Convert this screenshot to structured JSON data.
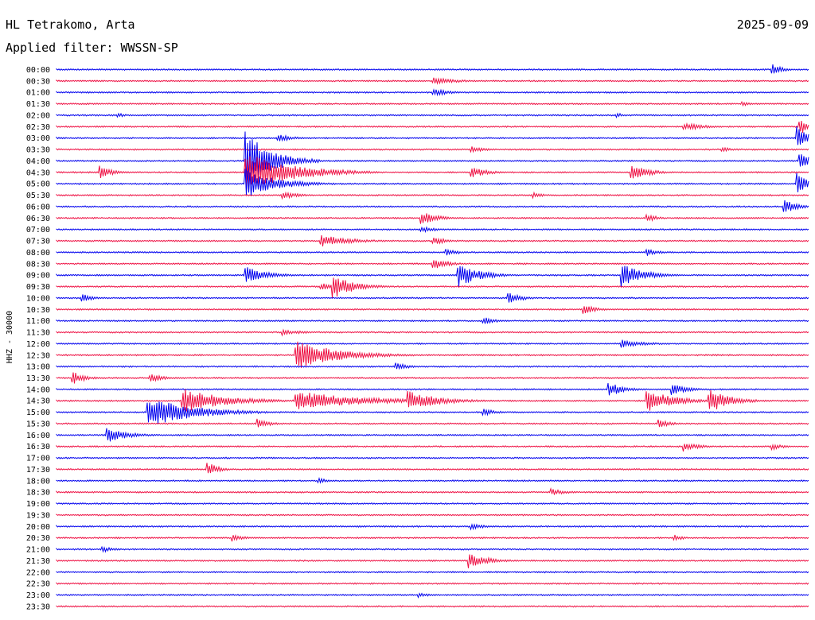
{
  "header": {
    "station": "HL Tetrakomo, Arta",
    "date": "2025-09-09",
    "filter": "Applied filter: WWSSN-SP"
  },
  "chart_data": {
    "type": "line",
    "title": "HL Tetrakomo, Arta",
    "subtitle": "Applied filter: WWSSN-SP",
    "date": "2025-09-09",
    "ylabel": "HHZ - 30000",
    "row_labels": [
      "00:00",
      "00:30",
      "01:00",
      "01:30",
      "02:00",
      "02:30",
      "03:00",
      "03:30",
      "04:00",
      "04:30",
      "05:00",
      "05:30",
      "06:00",
      "06:30",
      "07:00",
      "07:30",
      "08:00",
      "08:30",
      "09:00",
      "09:30",
      "10:00",
      "10:30",
      "11:00",
      "11:30",
      "12:00",
      "12:30",
      "13:00",
      "13:30",
      "14:00",
      "14:30",
      "15:00",
      "15:30",
      "16:00",
      "16:30",
      "17:00",
      "17:30",
      "18:00",
      "18:30",
      "19:00",
      "19:30",
      "20:00",
      "20:30",
      "21:00",
      "21:30",
      "22:00",
      "22:30",
      "23:00",
      "23:30"
    ],
    "row_minutes": 30,
    "series_colors": [
      "#0000ee",
      "#ee1144"
    ],
    "events": [
      {
        "row": 0,
        "min": 28.5,
        "amp": 1.2,
        "dur": 0.4
      },
      {
        "row": 1,
        "min": 15.0,
        "amp": 0.7,
        "dur": 1.0
      },
      {
        "row": 2,
        "min": 15.0,
        "amp": 0.8,
        "dur": 0.6
      },
      {
        "row": 3,
        "min": 27.3,
        "amp": 0.6,
        "dur": 0.3
      },
      {
        "row": 4,
        "min": 2.4,
        "amp": 0.6,
        "dur": 0.3
      },
      {
        "row": 4,
        "min": 22.3,
        "amp": 0.6,
        "dur": 0.3
      },
      {
        "row": 5,
        "min": 25.0,
        "amp": 0.8,
        "dur": 0.8
      },
      {
        "row": 5,
        "min": 29.6,
        "amp": 1.8,
        "dur": 0.4
      },
      {
        "row": 6,
        "min": 8.8,
        "amp": 0.8,
        "dur": 0.6
      },
      {
        "row": 6,
        "min": 29.5,
        "amp": 2.5,
        "dur": 0.5
      },
      {
        "row": 7,
        "min": 16.5,
        "amp": 0.8,
        "dur": 0.5
      },
      {
        "row": 7,
        "min": 26.5,
        "amp": 0.6,
        "dur": 0.4
      },
      {
        "row": 8,
        "min": 7.5,
        "amp": 6.0,
        "dur": 1.0
      },
      {
        "row": 8,
        "min": 29.6,
        "amp": 2.5,
        "dur": 0.4
      },
      {
        "row": 9,
        "min": 1.7,
        "amp": 1.4,
        "dur": 0.5
      },
      {
        "row": 9,
        "min": 7.5,
        "amp": 4.0,
        "dur": 1.8
      },
      {
        "row": 9,
        "min": 16.5,
        "amp": 1.2,
        "dur": 0.6
      },
      {
        "row": 9,
        "min": 22.9,
        "amp": 2.0,
        "dur": 0.6
      },
      {
        "row": 10,
        "min": 7.5,
        "amp": 3.0,
        "dur": 1.2
      },
      {
        "row": 10,
        "min": 29.5,
        "amp": 2.5,
        "dur": 0.4
      },
      {
        "row": 11,
        "min": 9.0,
        "amp": 0.8,
        "dur": 0.6
      },
      {
        "row": 11,
        "min": 19.0,
        "amp": 0.6,
        "dur": 0.4
      },
      {
        "row": 12,
        "min": 29.0,
        "amp": 1.5,
        "dur": 0.5
      },
      {
        "row": 13,
        "min": 14.5,
        "amp": 1.5,
        "dur": 0.6
      },
      {
        "row": 13,
        "min": 23.5,
        "amp": 1.0,
        "dur": 0.4
      },
      {
        "row": 14,
        "min": 14.5,
        "amp": 0.7,
        "dur": 0.6
      },
      {
        "row": 15,
        "min": 10.5,
        "amp": 1.2,
        "dur": 1.2
      },
      {
        "row": 15,
        "min": 15.0,
        "amp": 0.8,
        "dur": 0.6
      },
      {
        "row": 16,
        "min": 15.5,
        "amp": 0.8,
        "dur": 0.5
      },
      {
        "row": 16,
        "min": 23.5,
        "amp": 0.8,
        "dur": 0.5
      },
      {
        "row": 17,
        "min": 15.0,
        "amp": 1.4,
        "dur": 0.5
      },
      {
        "row": 18,
        "min": 7.5,
        "amp": 1.8,
        "dur": 0.8
      },
      {
        "row": 18,
        "min": 16.0,
        "amp": 2.5,
        "dur": 0.8
      },
      {
        "row": 18,
        "min": 22.5,
        "amp": 2.5,
        "dur": 0.8
      },
      {
        "row": 19,
        "min": 10.5,
        "amp": 0.8,
        "dur": 0.6
      },
      {
        "row": 19,
        "min": 11.0,
        "amp": 2.5,
        "dur": 0.8
      },
      {
        "row": 20,
        "min": 1.0,
        "amp": 0.8,
        "dur": 0.5
      },
      {
        "row": 20,
        "min": 18.0,
        "amp": 1.3,
        "dur": 0.5
      },
      {
        "row": 21,
        "min": 21.0,
        "amp": 1.0,
        "dur": 0.5
      },
      {
        "row": 22,
        "min": 17.0,
        "amp": 0.8,
        "dur": 0.5
      },
      {
        "row": 23,
        "min": 9.0,
        "amp": 0.6,
        "dur": 0.8
      },
      {
        "row": 24,
        "min": 22.5,
        "amp": 0.8,
        "dur": 1.0
      },
      {
        "row": 25,
        "min": 9.5,
        "amp": 3.0,
        "dur": 1.6
      },
      {
        "row": 26,
        "min": 13.5,
        "amp": 0.8,
        "dur": 0.5
      },
      {
        "row": 27,
        "min": 0.6,
        "amp": 1.4,
        "dur": 0.5
      },
      {
        "row": 27,
        "min": 3.7,
        "amp": 0.9,
        "dur": 0.6
      },
      {
        "row": 28,
        "min": 22.0,
        "amp": 1.5,
        "dur": 0.6
      },
      {
        "row": 28,
        "min": 24.5,
        "amp": 1.2,
        "dur": 0.6
      },
      {
        "row": 29,
        "min": 5.0,
        "amp": 2.5,
        "dur": 1.6
      },
      {
        "row": 29,
        "min": 9.5,
        "amp": 2.0,
        "dur": 2.5
      },
      {
        "row": 29,
        "min": 14.0,
        "amp": 2.0,
        "dur": 1.2
      },
      {
        "row": 29,
        "min": 23.5,
        "amp": 2.5,
        "dur": 1.0
      },
      {
        "row": 29,
        "min": 26.0,
        "amp": 2.5,
        "dur": 0.8
      },
      {
        "row": 30,
        "min": 3.6,
        "amp": 3.0,
        "dur": 1.8
      },
      {
        "row": 30,
        "min": 17.0,
        "amp": 0.8,
        "dur": 0.5
      },
      {
        "row": 31,
        "min": 8.0,
        "amp": 1.0,
        "dur": 0.5
      },
      {
        "row": 31,
        "min": 24.0,
        "amp": 0.8,
        "dur": 0.5
      },
      {
        "row": 32,
        "min": 2.0,
        "amp": 1.5,
        "dur": 0.8
      },
      {
        "row": 33,
        "min": 25.0,
        "amp": 1.0,
        "dur": 0.6
      },
      {
        "row": 33,
        "min": 28.5,
        "amp": 0.7,
        "dur": 0.5
      },
      {
        "row": 35,
        "min": 6.0,
        "amp": 1.6,
        "dur": 0.4
      },
      {
        "row": 36,
        "min": 10.4,
        "amp": 0.6,
        "dur": 0.4
      },
      {
        "row": 37,
        "min": 19.7,
        "amp": 0.7,
        "dur": 0.6
      },
      {
        "row": 40,
        "min": 16.5,
        "amp": 0.7,
        "dur": 0.5
      },
      {
        "row": 41,
        "min": 7.0,
        "amp": 0.7,
        "dur": 0.5
      },
      {
        "row": 41,
        "min": 24.6,
        "amp": 0.7,
        "dur": 0.4
      },
      {
        "row": 42,
        "min": 1.8,
        "amp": 0.7,
        "dur": 0.4
      },
      {
        "row": 43,
        "min": 16.4,
        "amp": 1.5,
        "dur": 0.8
      },
      {
        "row": 46,
        "min": 14.4,
        "amp": 0.6,
        "dur": 0.4
      }
    ]
  }
}
